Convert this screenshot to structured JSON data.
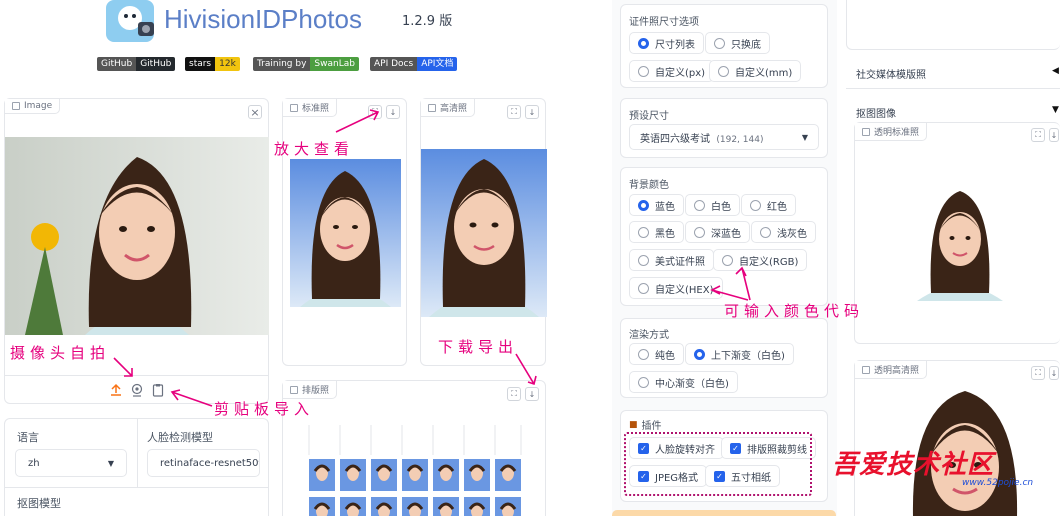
{
  "header": {
    "title": "HivisionIDPhotos",
    "version": "1.2.9 版",
    "badges": [
      {
        "left": "GitHub",
        "right": "GitHub",
        "right_color": "#24292e"
      },
      {
        "left": "stars",
        "right": "12k",
        "right_color": "#f1c40f"
      },
      {
        "left": "Training by",
        "right": "SwanLab",
        "right_color": "#4c9e40"
      },
      {
        "left": "API Docs",
        "right": "API文档",
        "right_color": "#2563eb"
      }
    ]
  },
  "input_panel": {
    "label": "Image",
    "close": "×"
  },
  "output": {
    "standard_label": "标准照",
    "hd_label": "高清照",
    "layout_label": "排版照"
  },
  "left_options": {
    "language_label": "语言",
    "language_value": "zh",
    "face_model_label": "人脸检测模型",
    "face_model_value": "retinaface-resnet50",
    "matting_label": "抠图模型"
  },
  "size_group": {
    "label": "证件照尺寸选项",
    "options": [
      "尺寸列表",
      "只换底",
      "自定义(px)",
      "自定义(mm)"
    ],
    "selected": "尺寸列表"
  },
  "preset": {
    "label": "预设尺寸",
    "value": "英语四六级考试",
    "dims": "(192, 144)"
  },
  "bg_color": {
    "label": "背景颜色",
    "options": [
      "蓝色",
      "白色",
      "红色",
      "黑色",
      "深蓝色",
      "浅灰色",
      "美式证件照",
      "自定义(RGB)",
      "自定义(HEX)"
    ],
    "selected": "蓝色"
  },
  "render": {
    "label": "渲染方式",
    "options": [
      "纯色",
      "上下渐变（白色)",
      "中心渐变（白色)"
    ],
    "selected": "上下渐变（白色)"
  },
  "plugins": {
    "label": "插件",
    "options": [
      "人脸旋转对齐",
      "排版照裁剪线",
      "JPEG格式",
      "五寸相纸"
    ]
  },
  "right_col": {
    "social_label": "社交媒体模版照",
    "matting_label": "抠图图像",
    "transparent_std": "透明标准照",
    "transparent_hd": "透明高清照"
  },
  "annotations": {
    "zoom": "放大查看",
    "camera": "摄像头自拍",
    "download": "下载导出",
    "clipboard": "剪贴板导入",
    "color_code": "可输入颜色代码"
  },
  "watermark": {
    "title": "吾爱技术社区",
    "url": "www.52pojie.cn"
  },
  "colors": {
    "accent": "#2563eb",
    "annotation": "#e6007e",
    "title": "#5b7fc7",
    "upload": "#f97316"
  }
}
